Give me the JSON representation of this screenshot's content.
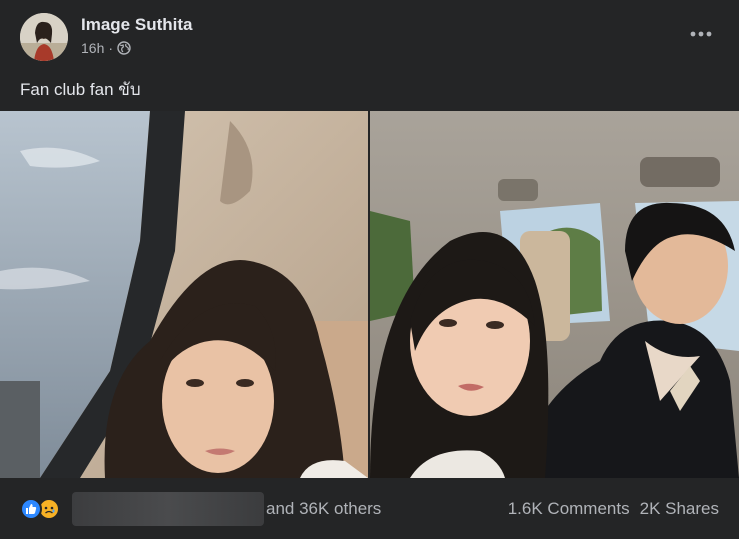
{
  "post": {
    "author_name": "Image Suthita",
    "time": "16h",
    "separator": "·",
    "privacy_icon": "globe-icon",
    "caption": "Fan club fan ขับ",
    "more_icon": "more-options-icon"
  },
  "photos": [
    {
      "description_icon": "selfie-photo-icon"
    },
    {
      "description_icon": "car-photo-icon"
    }
  ],
  "footer": {
    "reaction_icons": [
      "like-icon",
      "sad-icon"
    ],
    "others_text": "and 36K others",
    "comments": "1.6K Comments",
    "shares": "2K Shares"
  },
  "colors": {
    "background": "#242526",
    "text_primary": "#e4e6eb",
    "text_secondary": "#b0b3b8",
    "like_blue": "#2d88ff",
    "sad_yellow": "#f7b125"
  }
}
